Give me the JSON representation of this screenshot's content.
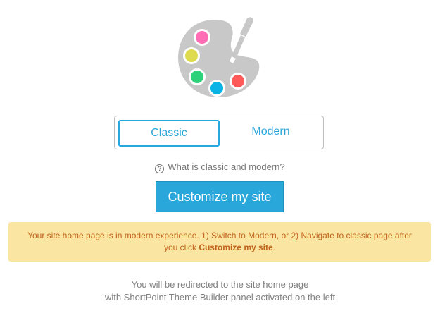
{
  "icon": {
    "name": "palette-icon",
    "colors": {
      "palette": "#c8c8c8",
      "brush": "#c8c8c8",
      "pink": "#ff6eb4",
      "yellow": "#dedb4e",
      "green": "#2bd27a",
      "blue": "#09b3e6",
      "red": "#ff5a5a"
    }
  },
  "toggle": {
    "classic_label": "Classic",
    "modern_label": "Modern",
    "selected": "Classic"
  },
  "help": {
    "icon": "question-circle-icon",
    "label": "What is classic and modern?"
  },
  "customize_button": {
    "label": "Customize my site"
  },
  "notice": {
    "text": "Your site home page is in modern experience. 1) Switch to Modern, or 2) Navigate to classic page after you click ",
    "bold": "Customize my site",
    "suffix": "."
  },
  "redirect": {
    "line1": "You will be redirected to the site home page",
    "line2": "with ShortPoint Theme Builder panel activated on the left"
  },
  "colors": {
    "accent": "#2aa7da",
    "notice_bg": "#fae5a2",
    "notice_text": "#c0641a",
    "muted_text": "#808080"
  }
}
